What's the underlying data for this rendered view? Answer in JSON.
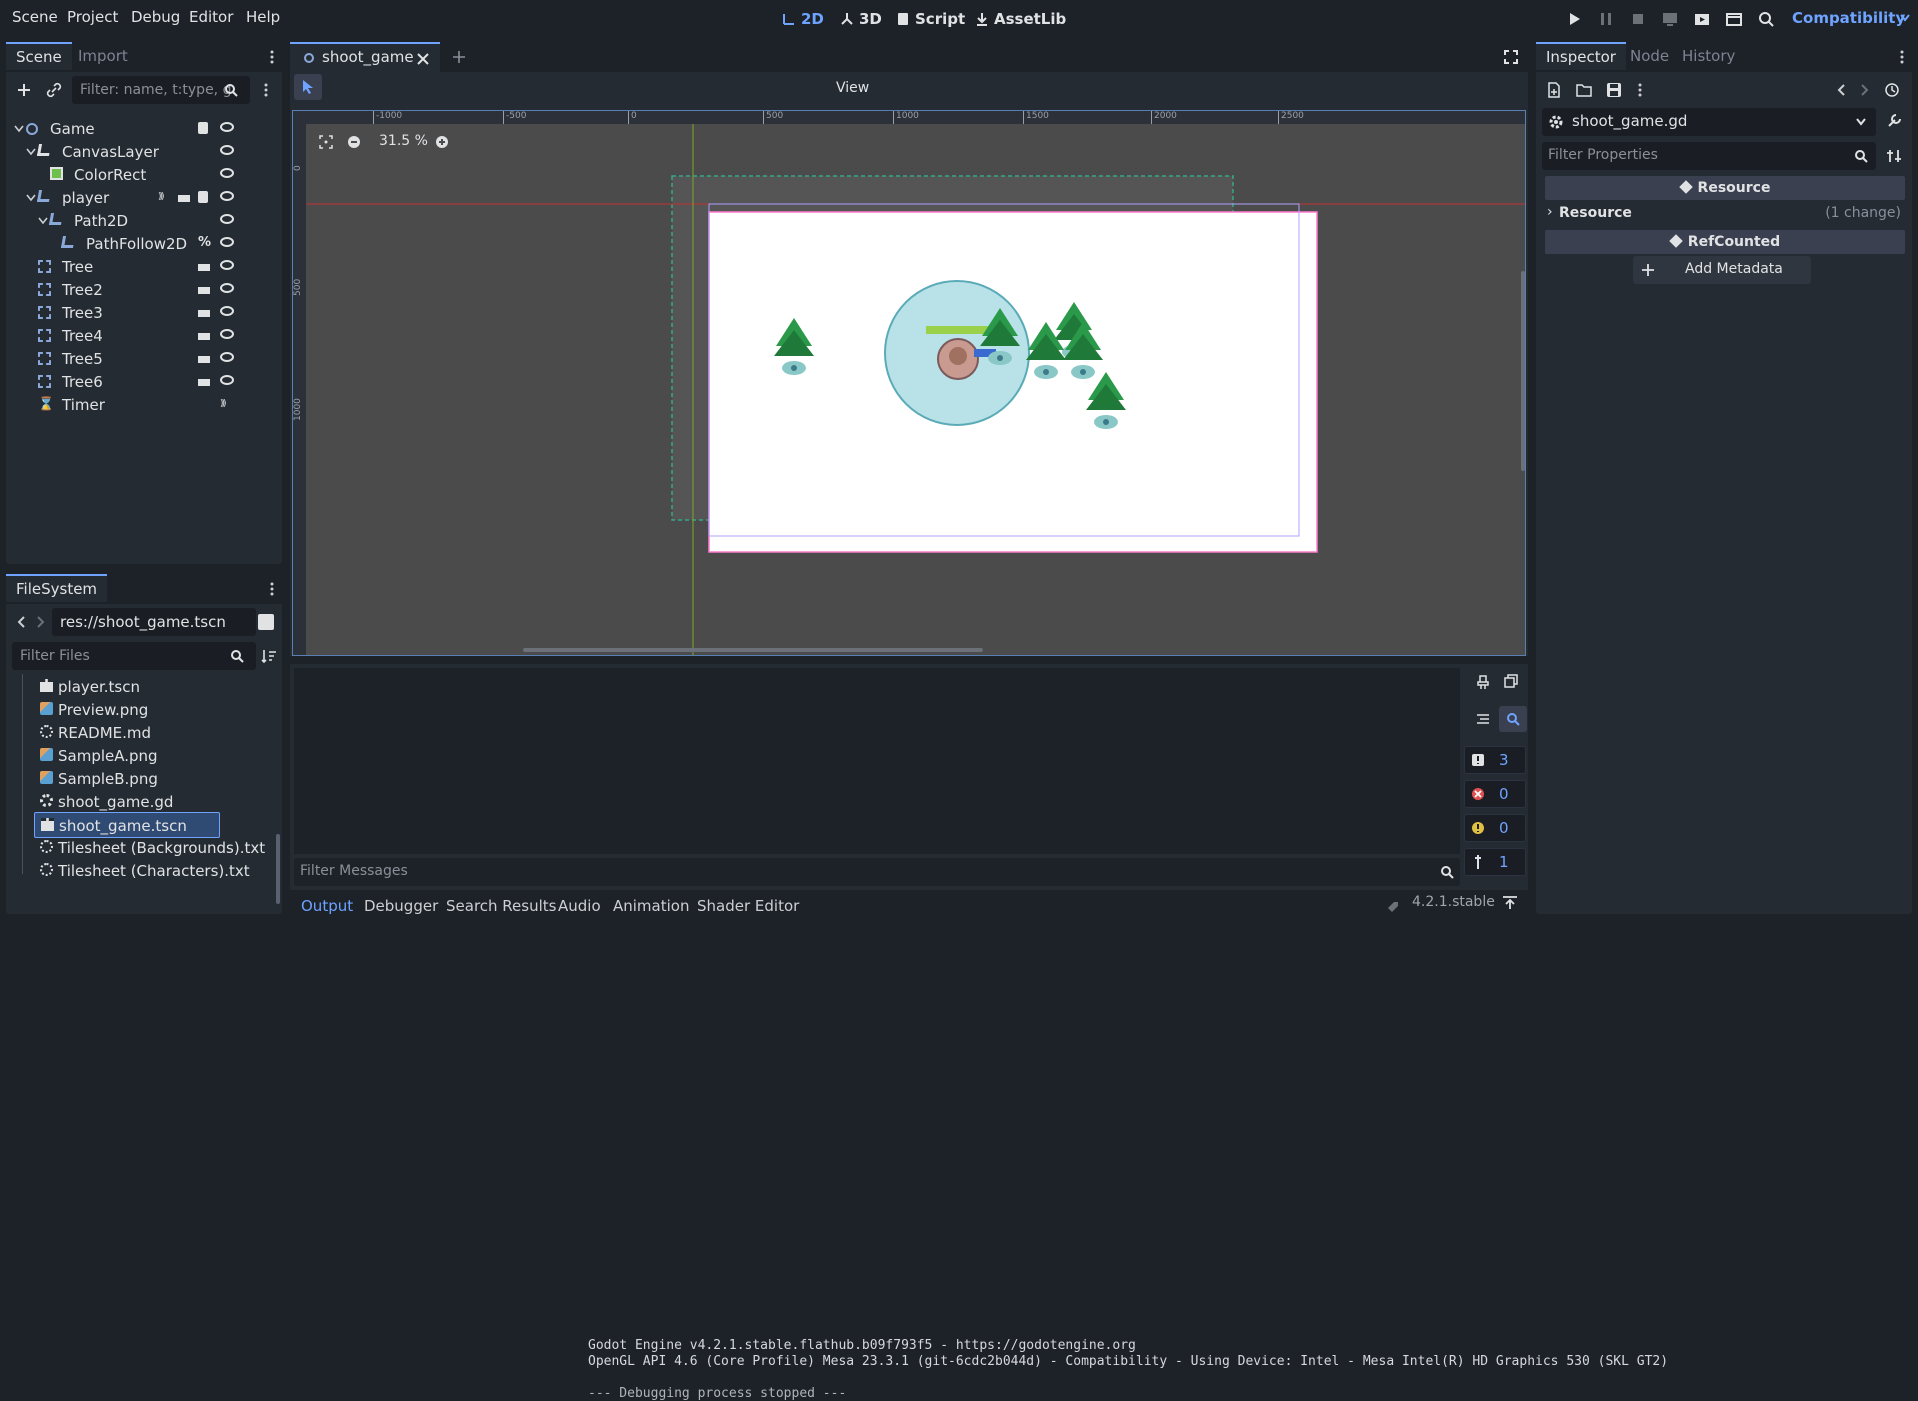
{
  "menu": [
    "Scene",
    "Project",
    "Debug",
    "Editor",
    "Help"
  ],
  "workspaces": [
    {
      "label": "2D",
      "icon": "2d-icon",
      "active": true
    },
    {
      "label": "3D",
      "icon": "3d-icon",
      "active": false
    },
    {
      "label": "Script",
      "icon": "script-icon",
      "active": false
    },
    {
      "label": "AssetLib",
      "icon": "assetlib-icon",
      "active": false
    }
  ],
  "renderer": "Compatibility",
  "scene_dock": {
    "tabs": [
      "Scene",
      "Import"
    ],
    "filter_placeholder": "Filter: name, t:type, g:",
    "nodes": [
      {
        "name": "Game",
        "icon": "node2d-icon",
        "depth": 0
      },
      {
        "name": "CanvasLayer",
        "icon": "canvaslayer-icon",
        "depth": 1
      },
      {
        "name": "ColorRect",
        "icon": "colorrect-icon",
        "depth": 2
      },
      {
        "name": "player",
        "icon": "characterbody-icon",
        "depth": 1
      },
      {
        "name": "Path2D",
        "icon": "path2d-icon",
        "depth": 2
      },
      {
        "name": "PathFollow2D",
        "icon": "pathfollow-icon",
        "depth": 3
      },
      {
        "name": "Tree",
        "icon": "instance-icon",
        "depth": 1
      },
      {
        "name": "Tree2",
        "icon": "instance-icon",
        "depth": 1
      },
      {
        "name": "Tree3",
        "icon": "instance-icon",
        "depth": 1
      },
      {
        "name": "Tree4",
        "icon": "instance-icon",
        "depth": 1
      },
      {
        "name": "Tree5",
        "icon": "instance-icon",
        "depth": 1
      },
      {
        "name": "Tree6",
        "icon": "instance-icon",
        "depth": 1
      },
      {
        "name": "Timer",
        "icon": "timer-icon",
        "depth": 1
      }
    ]
  },
  "filesystem": {
    "title": "FileSystem",
    "path": "res://shoot_game.tscn",
    "filter_placeholder": "Filter Files",
    "files": [
      {
        "name": "player.tscn",
        "icon": "scene-file-icon"
      },
      {
        "name": "Preview.png",
        "icon": "image-icon"
      },
      {
        "name": "README.md",
        "icon": "text-file-icon"
      },
      {
        "name": "SampleA.png",
        "icon": "image-icon"
      },
      {
        "name": "SampleB.png",
        "icon": "image-icon"
      },
      {
        "name": "shoot_game.gd",
        "icon": "gear-icon"
      },
      {
        "name": "shoot_game.tscn",
        "icon": "scene-file-icon",
        "selected": true
      },
      {
        "name": "Tilesheet (Backgrounds).txt",
        "icon": "text-file-icon"
      },
      {
        "name": "Tilesheet (Characters).txt",
        "icon": "text-file-icon"
      }
    ]
  },
  "editor": {
    "tab": "shoot_game",
    "zoom": "31.5 %",
    "view_label": "View",
    "ruler_h": [
      "-1000",
      "-500",
      "0",
      "500",
      "1000",
      "1500",
      "2000",
      "2500"
    ],
    "ruler_v": [
      "0",
      "500",
      "1000"
    ]
  },
  "output": {
    "lines": [
      "Godot Engine v4.2.1.stable.flathub.b09f793f5 - https://godotengine.org",
      "OpenGL API 4.6 (Core Profile) Mesa 23.3.1 (git-6cdc2b044d) - Compatibility - Using Device: Intel - Mesa Intel(R) HD Graphics 530 (SKL GT2)",
      "",
      "--- Debugging process stopped ---"
    ],
    "filter_placeholder": "Filter Messages",
    "counts": {
      "messages": "3",
      "errors": "0",
      "warnings": "0",
      "info": "1"
    },
    "tabs": [
      "Output",
      "Debugger",
      "Search Results",
      "Audio",
      "Animation",
      "Shader Editor"
    ],
    "version": "4.2.1.stable"
  },
  "inspector": {
    "tabs": [
      "Inspector",
      "Node",
      "History"
    ],
    "resource_name": "shoot_game.gd",
    "filter_placeholder": "Filter Properties",
    "section_resource": "Resource",
    "resource_row": "Resource",
    "resource_change": "(1 change)",
    "section_refcounted": "RefCounted",
    "add_metadata": "Add Metadata"
  },
  "colors": {
    "accent": "#6ea3ff",
    "panel": "#252b33",
    "bg": "#1d2229",
    "viewport": "#4b4b4b"
  }
}
